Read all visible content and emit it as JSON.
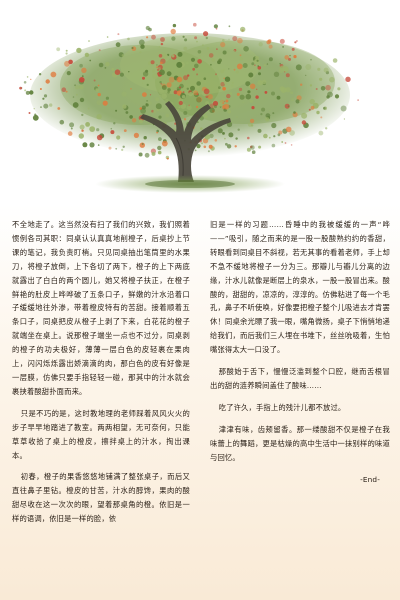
{
  "article": {
    "left_column": [
      "不全地走了。这当然没有扫了我们的兴致，我们照着惯例各司其职：同桌认认真真地削橙子，后桌抄上节课的笔记，我负责盯梢。只见同桌抽出笔筒里的水果刀，将橙子放倒，上下各切了两下，橙子的上下两底就露出了白白的两个圆儿，她又将橙子扶正，在橙子鲜艳的肚皮上哗哗破了五条口子，鲜嫩的汁水沿着口子缓缓地往外渗，带着橙皮特有的苦甜。接着顺着五条口子，同桌把皮从橙子上剥了下来，白花花的橙子就端坐在桌上。说那橙子端坐一点也不过分，同桌剥的橙子的功夫极好，薄薄一层白色的皮轻裹在果肉上，闪闪烁烁露出娇滴滴的肉，那白色的皮有好像是一层膜，仿佛只要手指轻轻一碰，那其中的汁水就会裹挟着酸甜扑面而来。",
      "只是不巧的是，这时教地理的老师踩着风风火火的步子早早地踏进了教室。两两相望，无可奈何，只能草草收拾了桌上的橙皮，擦拌桌上的汁水，掏出课本。",
      "初春，橙子的果香悠悠地铺满了整张桌子，而后又直往鼻子里钻。橙皮的甘苦，汁水的醇馋，果肉的酸甜尽收在这一次次的眼，望着那桌角的橙。依旧是一样的语调，依旧是一样的脸，依"
    ],
    "right_column": [
      "旧是一样的习题……昏睡中的我被缓缓的一声“哗——”吸引，随之而来的是一股一股酸熟约约的香甜，转眼看到同桌目不斜视，若无其事的看着老师，手上却不急不缓地将橙子一分为三。那瓣儿与瓣儿分离的边缘，汁水儿就像是断层上的泉水，一股一股冒出来。酸酸的，甜甜的，凉凉的，淳淳的。仿佛粘进了每一个毛孔，鼻子不听使唤，好像要把橙子整个儿吸进去才肯罢休！同桌余光瞟了我一眼，嘴角微扬，桌子下悄悄地递给我们，而后我们三人埋在书堆下，丝丝吮吸着，生怕嘴张得太大一口没了。",
      "那酸始于舌下，慢慢泛滥到整个口腔，继而舌根冒出的甜的涟养瞬间盖住了酸味……",
      "吃了许久，手指上的残汁儿都不放过。",
      "津津有味，齿颊留香。那一缕酸甜不仅是橙子在我味蕾上的舞蹈，更是枯燥的高中生活中一抹别样的味道与回忆。"
    ],
    "end_mark": "-End-"
  },
  "illustration": {
    "subject": "watercolor-orange-tree",
    "colors": {
      "foliage_green": "#5e7f3a",
      "foliage_light": "#9bb36a",
      "fruit_red": "#c64a3a",
      "fruit_orange": "#e07a3c",
      "trunk": "#4a463c",
      "grass": "#7a9a4a"
    }
  }
}
